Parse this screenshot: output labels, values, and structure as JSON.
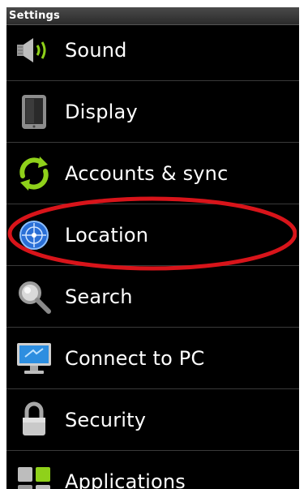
{
  "header": {
    "title": "Settings"
  },
  "settings": {
    "items": [
      {
        "label": "Sound",
        "icon": "speaker-icon"
      },
      {
        "label": "Display",
        "icon": "display-icon"
      },
      {
        "label": "Accounts & sync",
        "icon": "sync-icon"
      },
      {
        "label": "Location",
        "icon": "location-icon"
      },
      {
        "label": "Search",
        "icon": "magnifier-icon"
      },
      {
        "label": "Connect to PC",
        "icon": "computer-icon"
      },
      {
        "label": "Security",
        "icon": "padlock-icon"
      },
      {
        "label": "Applications",
        "icon": "applications-icon"
      }
    ]
  },
  "annotation": {
    "highlight_color": "#d8141a",
    "highlighted_item": "Location"
  },
  "colors": {
    "background": "#000000",
    "text": "#ffffff",
    "sync_green": "#8fd11a",
    "location_blue": "#2a6fd6"
  }
}
